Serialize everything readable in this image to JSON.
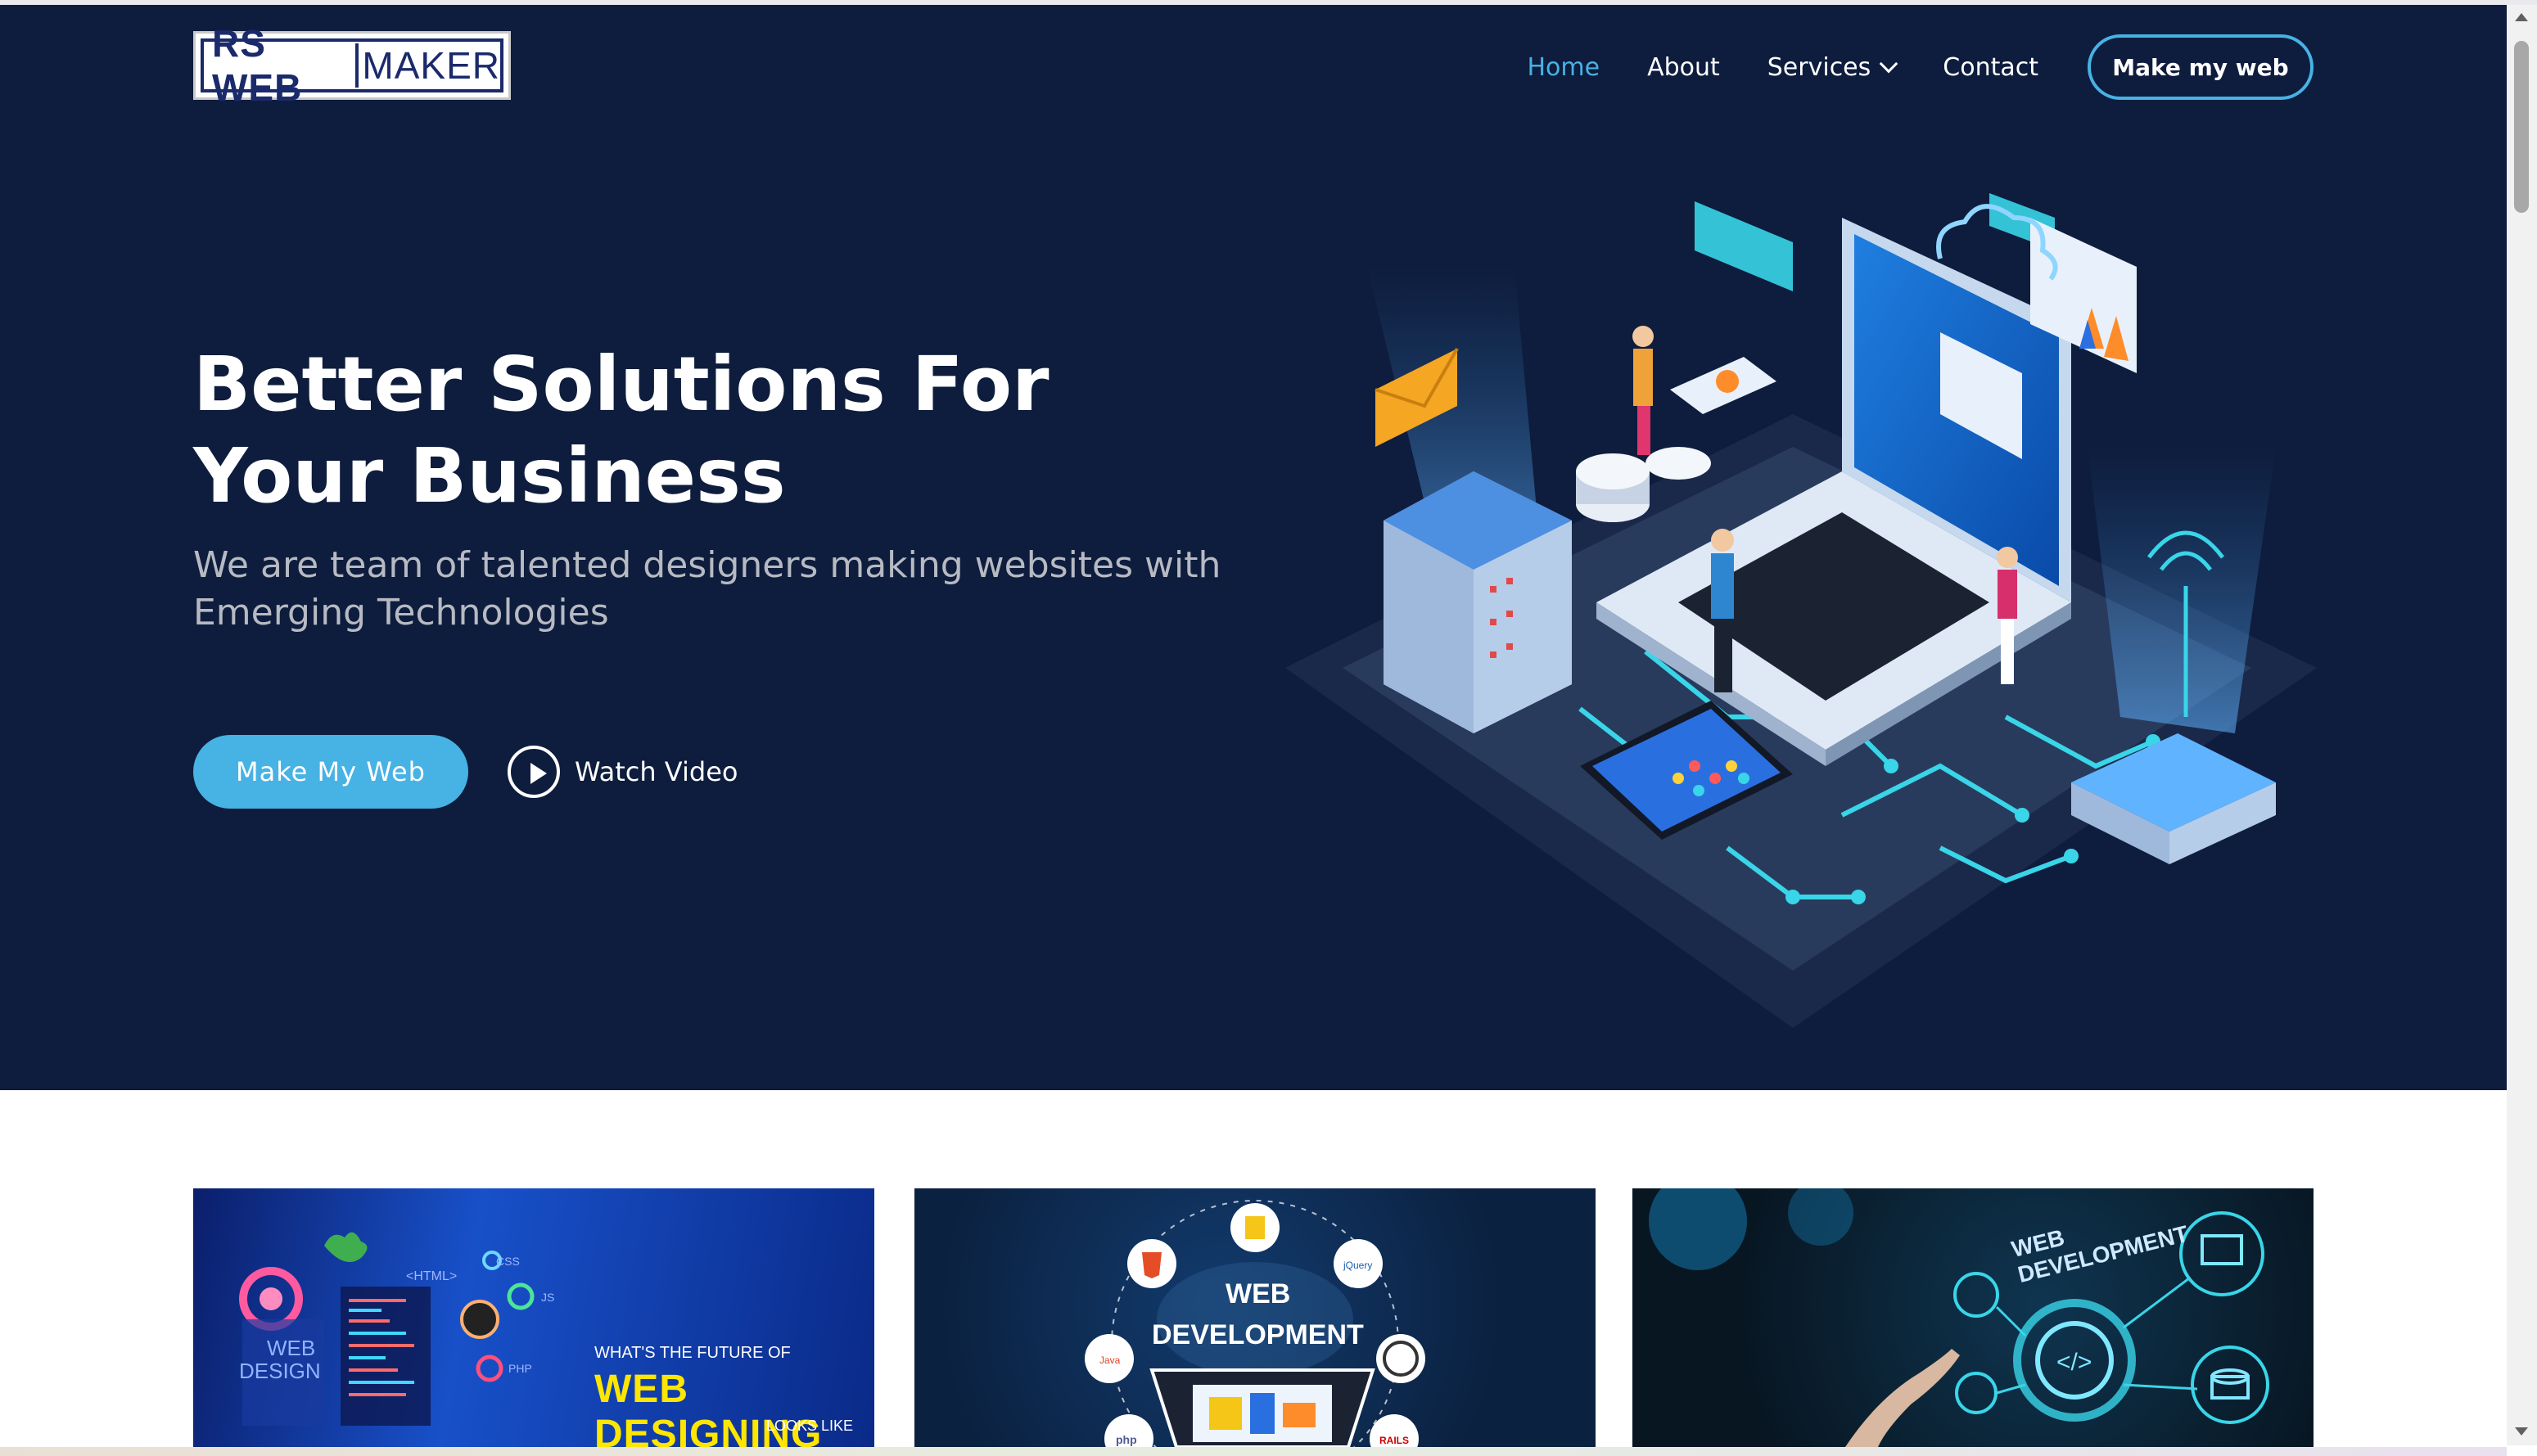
{
  "logo": {
    "part1": "RS WEB",
    "part2": "MAKER"
  },
  "nav": {
    "items": [
      {
        "label": "Home",
        "active": true
      },
      {
        "label": "About",
        "active": false
      },
      {
        "label": "Services",
        "active": false,
        "has_dropdown": true
      },
      {
        "label": "Contact",
        "active": false
      }
    ],
    "cta_label": "Make my web"
  },
  "hero": {
    "title": "Better Solutions For Your Business",
    "subtitle": "We are team of talented designers making websites with Emerging Technologies",
    "primary_button": "Make My Web",
    "video_button": "Watch Video"
  },
  "cards": [
    {
      "heading_small": "WHAT'S THE FUTURE OF",
      "heading_big": "WEB DESIGNING",
      "heading_tail": "LOOKS LIKE",
      "side_text_1": "WEB",
      "side_text_2": "DESIGN",
      "tech_labels": [
        "HTML",
        "CSS",
        "JS",
        "PHP"
      ]
    },
    {
      "title_line1": "WEB",
      "title_line2": "DEVELOPMENT",
      "tech_labels": [
        "JS",
        "HTML",
        "jQuery",
        "Java",
        "php",
        "RAILS"
      ]
    },
    {
      "title_line1": "WEB",
      "title_line2": "DEVELOPMENT"
    }
  ],
  "colors": {
    "hero_bg": "#0e1d3d",
    "accent": "#47b2e4",
    "text_muted": "#b7bac2",
    "card_yellow": "#ffe600"
  }
}
